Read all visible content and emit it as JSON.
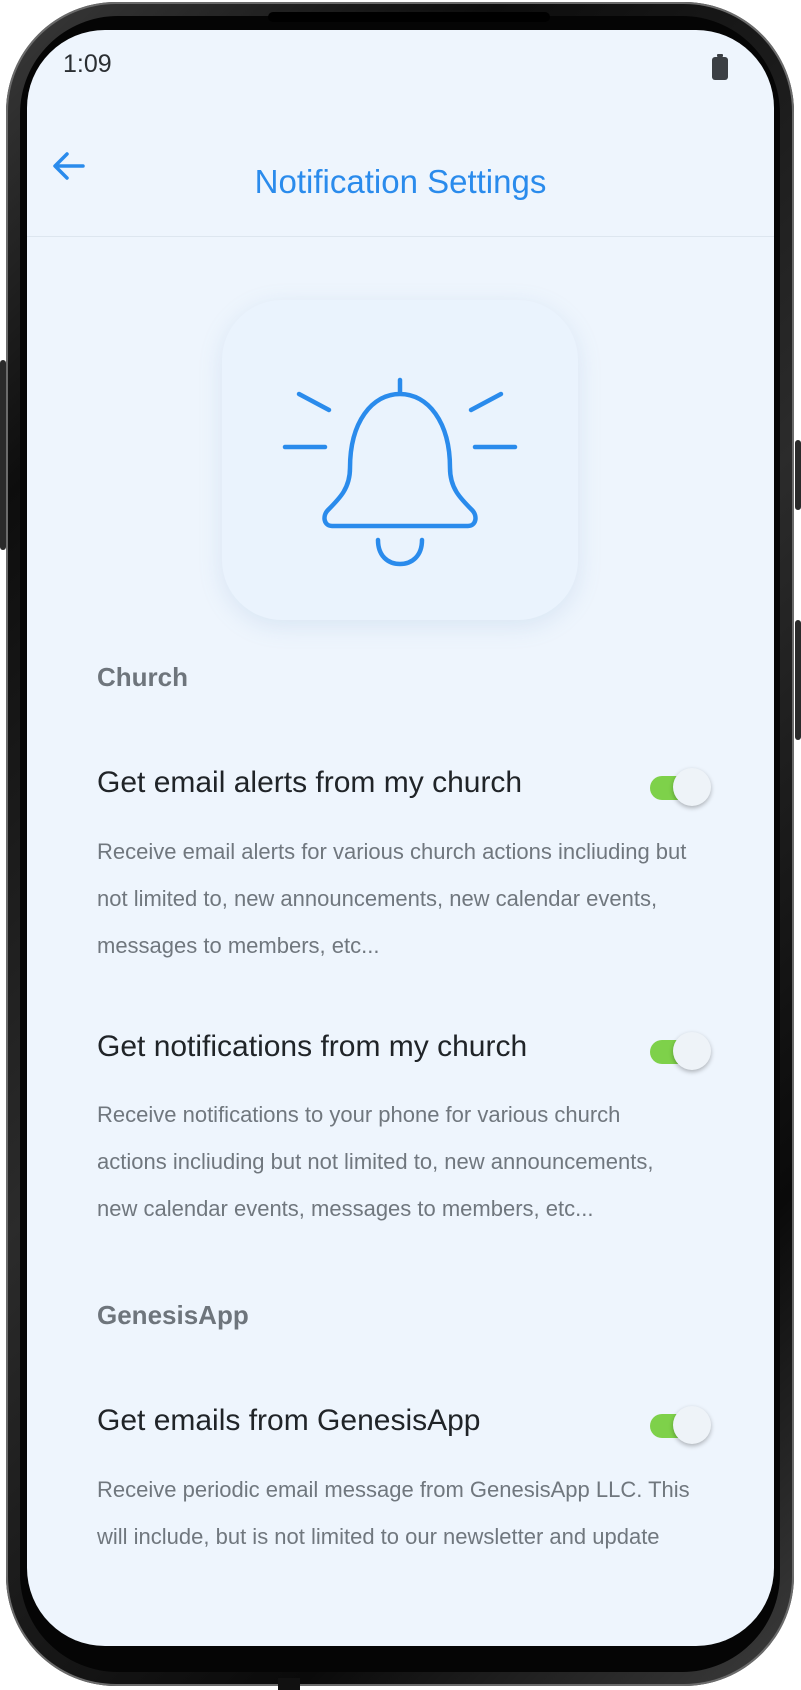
{
  "status_bar": {
    "time": "1:09",
    "battery_icon": "battery-full-icon"
  },
  "header": {
    "back_icon": "arrow-left-icon",
    "title": "Notification Settings"
  },
  "hero": {
    "icon": "bell-ringing-icon"
  },
  "colors": {
    "accent": "#2a8bec",
    "toggle_on": "#7ed14a",
    "background": "#eef5fd"
  },
  "sections": [
    {
      "header": "Church",
      "settings": [
        {
          "title": "Get email alerts from my church",
          "description": "Receive email alerts for various church actions incliuding but not limited to, new announcements, new calendar events, messages to members, etc...",
          "enabled": true
        },
        {
          "title": "Get notifications from my church",
          "description": "Receive notifications to your phone for various church actions incliuding but not limited to, new announcements, new calendar events, messages to members, etc...",
          "enabled": true
        }
      ]
    },
    {
      "header": "GenesisApp",
      "settings": [
        {
          "title": "Get emails from GenesisApp",
          "description": "Receive periodic email message from GenesisApp LLC. This will include, but is not limited to our newsletter and update",
          "enabled": true
        }
      ]
    }
  ]
}
